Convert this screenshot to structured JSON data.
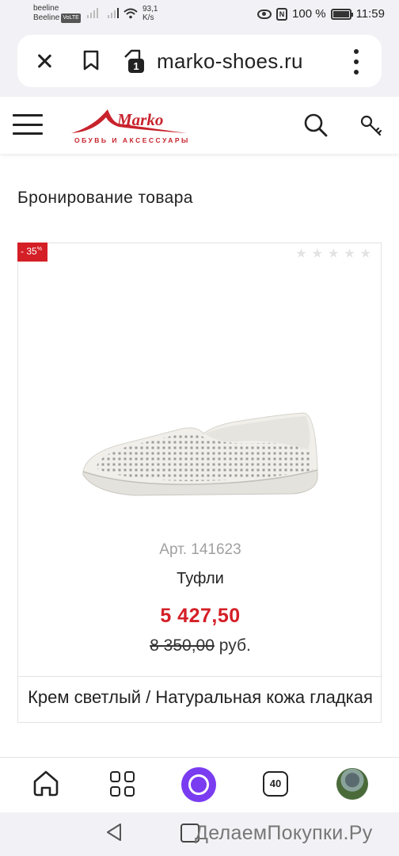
{
  "status_bar": {
    "carrier1": "beeline",
    "carrier2": "Beeline",
    "volte": "VoLTE",
    "speed_value": "93,1",
    "speed_unit": "K/s",
    "battery": "100 %",
    "time": "11:59",
    "nfc": "N"
  },
  "browser": {
    "url": "marko-shoes.ru",
    "tab_count": "1"
  },
  "site": {
    "logo_text": "Marko",
    "tagline": "ОБУВЬ И АКСЕССУАРЫ",
    "brand_color": "#c8232c"
  },
  "page": {
    "title": "Бронирование товара"
  },
  "product": {
    "discount": "- 35",
    "discount_unit": "%",
    "rating": 0,
    "rating_max": 5,
    "article": "Арт. 141623",
    "name": "Туфли",
    "price": "5 427,50",
    "old_price": "8 350,00",
    "currency": "руб.",
    "color_material": "Крем светлый / Натуральная кожа гладкая",
    "price_color": "#d41f26"
  },
  "toolbar": {
    "tabs_count": "40",
    "assistant_color": "#7a3cf0"
  },
  "navbar": {
    "watermark": "ДелаемПокупки.Ру"
  }
}
